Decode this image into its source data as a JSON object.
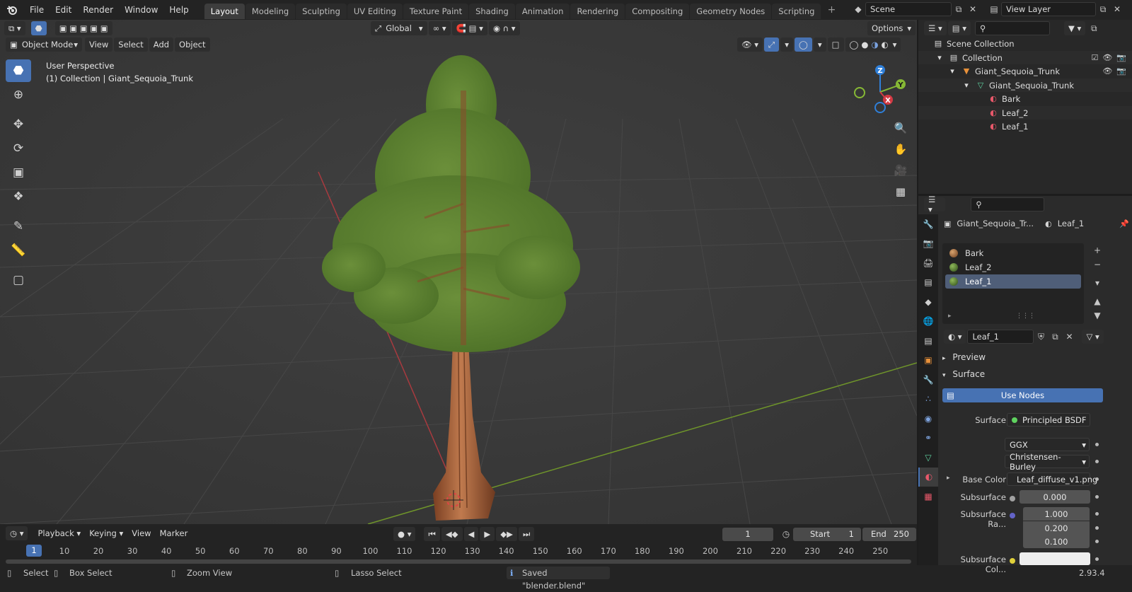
{
  "topbar": {
    "menu": [
      "File",
      "Edit",
      "Render",
      "Window",
      "Help"
    ],
    "workspaces": [
      {
        "label": "Layout",
        "active": true
      },
      {
        "label": "Modeling"
      },
      {
        "label": "Sculpting"
      },
      {
        "label": "UV Editing"
      },
      {
        "label": "Texture Paint"
      },
      {
        "label": "Shading"
      },
      {
        "label": "Animation"
      },
      {
        "label": "Rendering"
      },
      {
        "label": "Compositing"
      },
      {
        "label": "Geometry Nodes"
      },
      {
        "label": "Scripting"
      }
    ],
    "scene": "Scene",
    "view_layer": "View Layer"
  },
  "viewport": {
    "mode": "Object Mode",
    "menus": [
      "View",
      "Select",
      "Add",
      "Object"
    ],
    "orientation": "Global",
    "options": "Options",
    "perspective": "User Perspective",
    "collection_info": "(1) Collection | Giant_Sequoia_Trunk",
    "gizmo": {
      "x": "X",
      "y": "Y",
      "z": "Z"
    }
  },
  "timeline": {
    "menus": [
      "Playback",
      "Keying",
      "View",
      "Marker"
    ],
    "current_frame": "1",
    "start_label": "Start",
    "start": "1",
    "end_label": "End",
    "end": "250",
    "ticks": [
      "10",
      "20",
      "30",
      "40",
      "50",
      "60",
      "70",
      "80",
      "90",
      "100",
      "110",
      "120",
      "130",
      "140",
      "150",
      "160",
      "170",
      "180",
      "190",
      "200",
      "210",
      "220",
      "230",
      "240",
      "250"
    ],
    "playhead": "1"
  },
  "statusbar": {
    "select": "Select",
    "box_select": "Box Select",
    "zoom_view": "Zoom View",
    "lasso_select": "Lasso Select",
    "message": "Saved \"blender.blend\"",
    "version": "2.93.4"
  },
  "outliner": {
    "rows": [
      {
        "label": "Scene Collection"
      },
      {
        "label": "Collection"
      },
      {
        "label": "Giant_Sequoia_Trunk"
      },
      {
        "label": "Giant_Sequoia_Trunk"
      },
      {
        "label": "Bark"
      },
      {
        "label": "Leaf_2"
      },
      {
        "label": "Leaf_1"
      }
    ]
  },
  "properties": {
    "object_name": "Giant_Sequoia_Tr...",
    "material_name": "Leaf_1",
    "slots": [
      "Bark",
      "Leaf_2",
      "Leaf_1"
    ],
    "material_field": "Leaf_1",
    "preview": "Preview",
    "surface_panel": "Surface",
    "use_nodes": "Use Nodes",
    "surface_label": "Surface",
    "surface_value": "Principled BSDF",
    "distribution": "GGX",
    "subsurface_method": "Christensen-Burley",
    "base_color_label": "Base Color",
    "base_color_value": "Leaf_diffuse_v1.png",
    "subsurface_label": "Subsurface",
    "subsurface_value": "0.000",
    "subsurface_radius_label": "Subsurface Ra...",
    "subsurface_radius": [
      "1.000",
      "0.200",
      "0.100"
    ],
    "subsurface_color_label": "Subsurface Col..."
  },
  "colors": {
    "accent": "#4772b3",
    "x_axis": "#d33a44",
    "y_axis": "#86b835",
    "z_axis": "#2f7fd8"
  }
}
